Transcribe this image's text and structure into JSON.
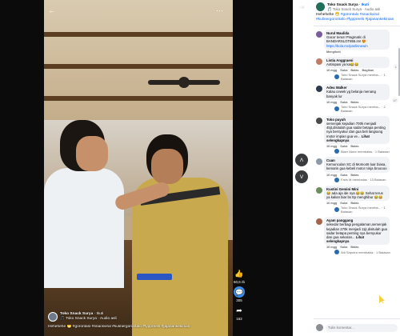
{
  "video": {
    "account_name": "Toko Snack Surya",
    "follow": "· Ikuti",
    "sub": "🎵 Toko Snack Surya · Audio asli",
    "caption": "Hehehehe 😁 #gorontalo #snackviral #kulinergorontalo #fyppreels #jajanankekinian",
    "likes": "60,6 rb",
    "comments": "305",
    "shares": "162"
  },
  "post": {
    "account_name": "Toko Snack Surya",
    "follow": "· Ikuti",
    "sub": "🎵 Toko Snack Surya · Audio asli",
    "text_lead": "Hehehehe 😁",
    "text_tags": "#gorontalo #snackviral #kulinergorontalo #fyppreels #jajanankekinian"
  },
  "comments": [
    {
      "name": "Nurul Maulida",
      "text": "Gacor terus! Pragmatic di BANDARSLOT855.im! 😍",
      "link": "https://bola.mx/paslinnewin",
      "actions": [
        "Mengikuti"
      ],
      "reply": ""
    },
    {
      "name": "Listia Anggraeni",
      "text": "Antisipasi ya ka😂😂",
      "actions": [
        "16 mgg",
        "Suka",
        "Balas",
        "Bagikan"
      ],
      "react": "1",
      "reply": "Toko Snack Surya memba... · 1 Balasan"
    },
    {
      "name": "Adea Walker",
      "text": "Kalau cewek yg belanja menang banyak lur",
      "actions": [
        "16 mgg",
        "Suka",
        "Balas"
      ],
      "react": "47",
      "reply": "Toko Snack Surya memba... · 2 Balasan"
    },
    {
      "name": "Toko puyuh",
      "text": "semenjak kejadian 700k menjadi 45jt,disitulah gua sadar betapa penting nya bersyukur dan gua beli langsung motor impian gua ve...",
      "more": "Lihat selengkapnya",
      "actions": [
        "16 mgg",
        "Suka",
        "Balas"
      ],
      "react": "",
      "reply": "Blazr Maxx membalas · 1 Balasan"
    },
    {
      "name": "Cuan",
      "text": "Kemunculan SC di Momo46 luar biasa, kemarin gua kebeli motor ninja brooooo",
      "actions": [
        "16 mgg",
        "Suka",
        "Balas"
      ],
      "react": "",
      "reply": "Faris M membalas · 13 Balasan"
    },
    {
      "name": "Kustini Gemini Mini",
      "text": "😂 ada aja ide nya 😂😂 Sehat terus ya kalian biar bs ttp menghibur 😂😂",
      "actions": [
        "16 mgg",
        "Suka",
        "Balas"
      ],
      "react": "",
      "reply": "Toko Snack Surya memba... · 1 Balasan"
    },
    {
      "name": "Ayam panggang",
      "text": "sekedar berbagi pengalaman,semenjak kejadian 270k menjadi 11jt,disitulah gua sadar betapa penting nya bersyukur dan gua sekaran...",
      "more": "Lihat selengkapnya",
      "actions": [
        "16 mgg",
        "Suka",
        "Balas"
      ],
      "react": "",
      "reply": "Adi Saputra membalas · 1 Balasan"
    }
  ],
  "comment_input": {
    "placeholder": "Tulis komentar..."
  },
  "colors": {
    "accent": "#0866ff",
    "panel_bg": "#ffffff",
    "video_bg": "#0b0b0b",
    "bubble_bg": "#f0f2f5"
  },
  "icons": [
    "arrow-back-icon",
    "more-icon",
    "like-icon",
    "comment-icon",
    "share-icon",
    "chevron-up-icon",
    "chevron-down-icon",
    "collapse-icon"
  ]
}
